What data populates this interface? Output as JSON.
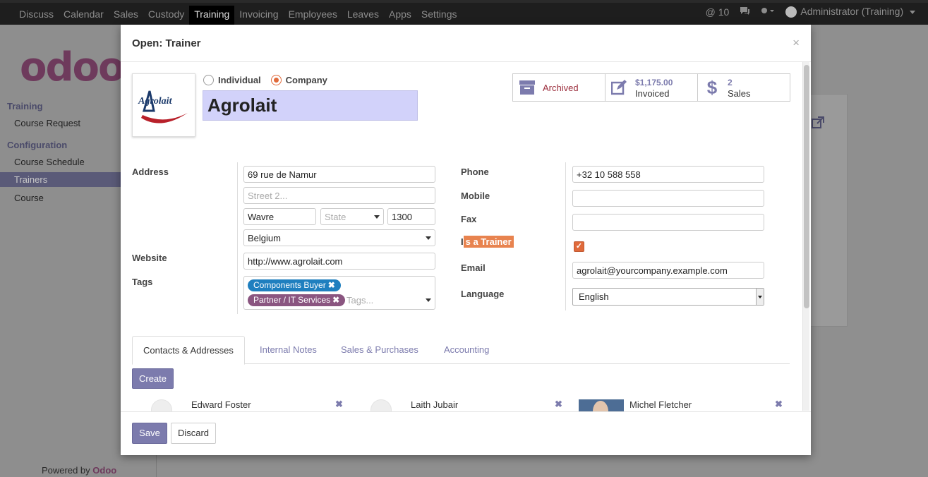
{
  "topbar": {
    "menu": [
      "Discuss",
      "Calendar",
      "Sales",
      "Custody",
      "Training",
      "Invoicing",
      "Employees",
      "Leaves",
      "Apps",
      "Settings"
    ],
    "active_menu": "Training",
    "mentions": "@ 10",
    "user": "Administrator (Training)"
  },
  "sidebar": {
    "logo": "odoo",
    "section_training": "Training",
    "course_request": "Course Request",
    "section_configuration": "Configuration",
    "course_schedule": "Course Schedule",
    "trainers": "Trainers",
    "course": "Course",
    "powered_prefix": "Powered by ",
    "powered_brand": "Odoo"
  },
  "modal": {
    "title": "Open: Trainer",
    "close": "×",
    "logo_text": "Agrolait",
    "radio_individual": "Individual",
    "radio_company": "Company",
    "company_type_selected": "Company",
    "name": "Agrolait",
    "stats": {
      "archived": "Archived",
      "invoiced_value": "$1,175.00",
      "invoiced_label": "Invoiced",
      "sales_value": "2",
      "sales_label": "Sales"
    },
    "labels": {
      "address": "Address",
      "website": "Website",
      "tags": "Tags",
      "phone": "Phone",
      "mobile": "Mobile",
      "fax": "Fax",
      "is_trainer_first": "I",
      "is_trainer_rest": "s a Trainer",
      "email": "Email",
      "language": "Language"
    },
    "fields": {
      "street": "69 rue de Namur",
      "street2_placeholder": "Street 2...",
      "city": "Wavre",
      "state_placeholder": "State",
      "zip": "1300",
      "country": "Belgium",
      "website": "http://www.agrolait.com",
      "phone": "+32 10 588 558",
      "mobile": "",
      "fax": "",
      "is_trainer": true,
      "email": "agrolait@yourcompany.example.com",
      "language": "English"
    },
    "tags": [
      {
        "label": "Components Buyer",
        "color": "#1f7fbf"
      },
      {
        "label": "Partner / IT Services",
        "color": "#8a5580"
      }
    ],
    "tags_placeholder": "Tags...",
    "tabs": [
      "Contacts & Addresses",
      "Internal Notes",
      "Sales & Purchases",
      "Accounting"
    ],
    "active_tab": "Contacts & Addresses",
    "create_label": "Create",
    "contacts": [
      {
        "name": "Edward Foster"
      },
      {
        "name": "Laith Jubair"
      },
      {
        "name": "Michel Fletcher"
      }
    ],
    "save_label": "Save",
    "discard_label": "Discard"
  },
  "colors": {
    "accent": "#7c7bad",
    "highlight": "#e06a3b",
    "archived": "#9b2c3b"
  }
}
